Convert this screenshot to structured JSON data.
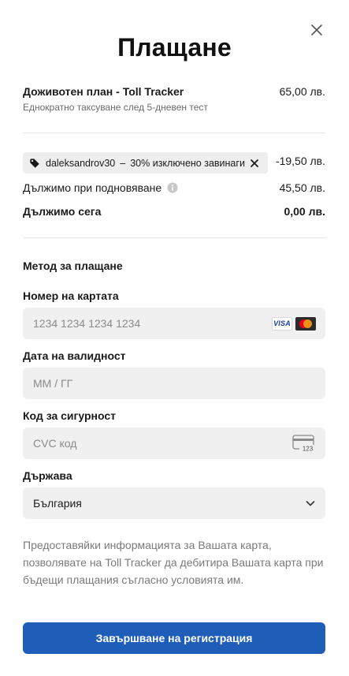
{
  "dialog": {
    "title": "Плащане",
    "close_icon": "close-icon"
  },
  "plan": {
    "name": "Доживотен план - Toll Tracker",
    "price": "65,00 лв.",
    "subtitle": "Еднократно таксуване след 5-дневен тест"
  },
  "coupon": {
    "icon": "tag-icon",
    "code": "daleksandrov30",
    "separator": "–",
    "description": "30% изключено завинаги",
    "remove_icon": "close-icon",
    "amount": "-19,50 лв."
  },
  "summary": {
    "renewal_label": "Дължимо при подновяване",
    "renewal_value": "45,50 лв.",
    "due_now_label": "Дължимо сега",
    "due_now_value": "0,00 лв."
  },
  "payment": {
    "section_title": "Метод за плащане",
    "card_number_label": "Номер на картата",
    "card_number_placeholder": "1234 1234 1234 1234",
    "card_brands": [
      "VISA",
      "mastercard"
    ],
    "expiry_label": "Дата на валидност",
    "expiry_placeholder": "ММ / ГГ",
    "cvc_label": "Код за сигурност",
    "cvc_placeholder": "CVC код",
    "cvc_icon_text": "123",
    "country_label": "Държава",
    "country_value": "България"
  },
  "disclaimer": "Предоставяйки информацията за Вашата карта, позволявате на Toll Tracker да дебитира Вашата карта при бъдещи плащания съгласно условията им.",
  "submit_label": "Завършване на регистрация",
  "colors": {
    "primary_button": "#1f5eb8",
    "field_background": "#f0f0f0",
    "chip_background": "#eeeeee"
  }
}
